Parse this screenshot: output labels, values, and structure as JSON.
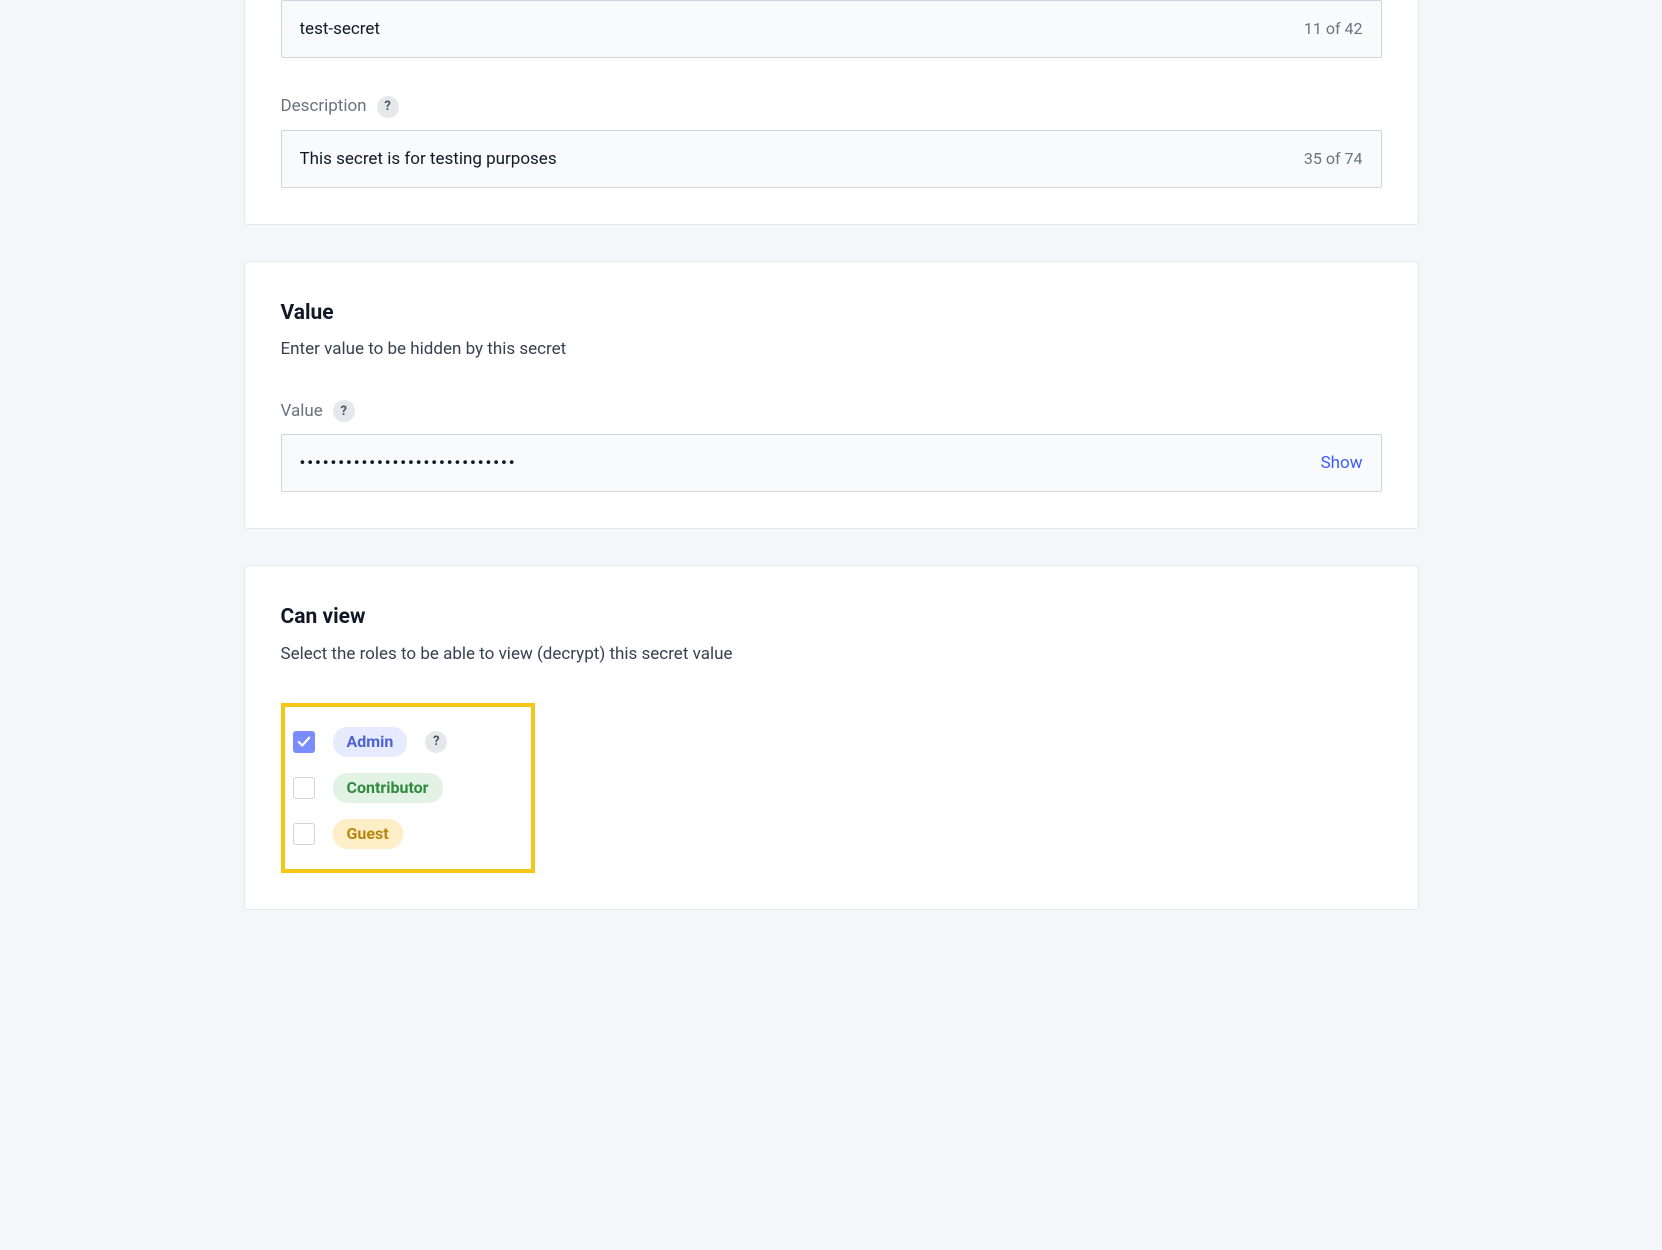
{
  "name_field": {
    "value": "test-secret",
    "counter": "11 of 42"
  },
  "description_field": {
    "label": "Description",
    "value": "This secret is for testing purposes",
    "counter": "35 of 74"
  },
  "value_section": {
    "title": "Value",
    "subtitle": "Enter value to be hidden by this secret",
    "label": "Value",
    "masked": "••••••••••••••••••••••••••••",
    "show_label": "Show"
  },
  "canview_section": {
    "title": "Can view",
    "subtitle": "Select the roles to be able to view (decrypt) this secret value",
    "roles": [
      {
        "name": "Admin",
        "checked": true,
        "help": true,
        "style": "admin"
      },
      {
        "name": "Contributor",
        "checked": false,
        "help": false,
        "style": "contributor"
      },
      {
        "name": "Guest",
        "checked": false,
        "help": false,
        "style": "guest"
      }
    ]
  },
  "help_glyph": "?"
}
